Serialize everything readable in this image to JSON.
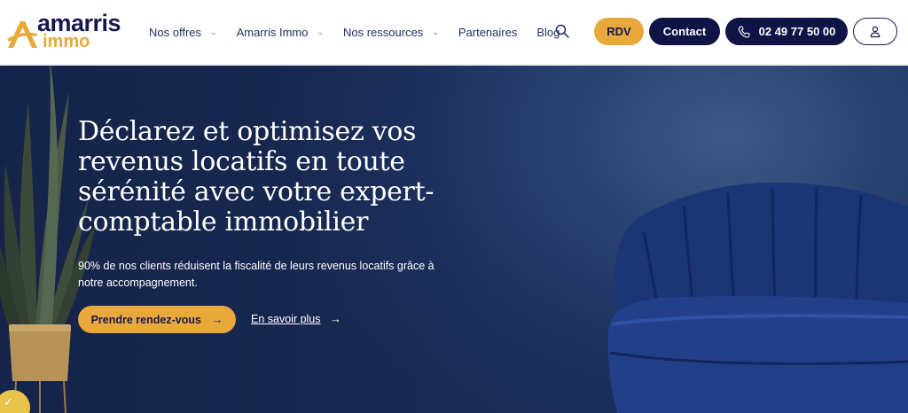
{
  "logo": {
    "line1": "amarris",
    "line2": "immo"
  },
  "nav": {
    "items": [
      {
        "label": "Nos offres",
        "dropdown": true
      },
      {
        "label": "Amarris Immo",
        "dropdown": true
      },
      {
        "label": "Nos ressources",
        "dropdown": true
      },
      {
        "label": "Partenaires",
        "dropdown": false
      },
      {
        "label": "Blog",
        "dropdown": false
      }
    ],
    "search_icon": "search-icon"
  },
  "header_buttons": {
    "rdv": "RDV",
    "contact": "Contact",
    "phone": "02 49 77 50 00",
    "phone_icon": "phone-icon",
    "account_icon": "user-icon"
  },
  "hero": {
    "title": "Déclarez et optimisez vos revenus locatifs en toute sérénité avec votre expert-comptable immobilier",
    "subtitle": "90% de nos clients réduisent la fiscalité de leurs revenus locatifs grâce à notre accompagnement.",
    "cta_label": "Prendre rendez-vous",
    "cta_arrow": "→",
    "more_label": "En savoir plus",
    "more_arrow": "→"
  },
  "colors": {
    "navy": "#0e1446",
    "brand_orange": "#e8a83a",
    "hero_blue": "#1e3260"
  }
}
